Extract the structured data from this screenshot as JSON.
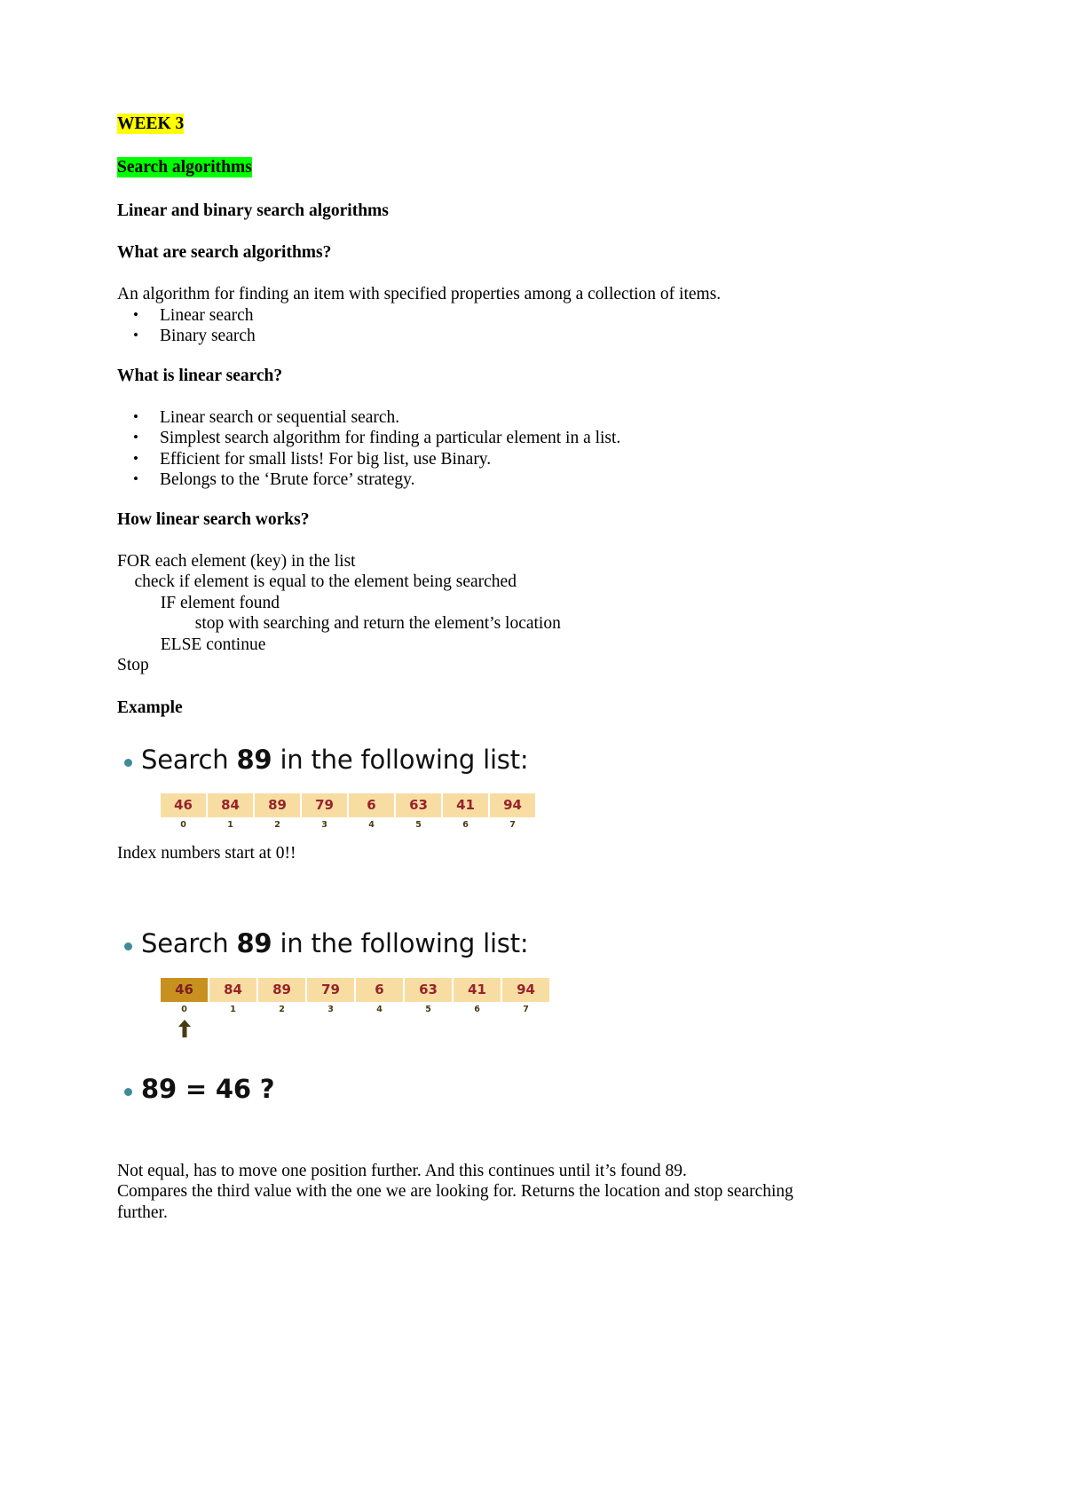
{
  "document": {
    "week_heading": "WEEK 3",
    "topic_heading": "Search algorithms",
    "subtitle": "Linear and binary search algorithms",
    "q1": "What are search algorithms?",
    "definition": "An algorithm for finding an item with specified properties among a collection of items.",
    "definition_bullets": [
      "Linear search",
      "Binary search"
    ],
    "q2": "What is linear search?",
    "linear_bullets": [
      "Linear search or sequential search.",
      "Simplest search algorithm for finding a particular element in a list.",
      "Efficient for small lists! For big list, use Binary.",
      "Belongs to the ‘Brute force’ strategy."
    ],
    "q3": "How linear search works?",
    "pseudocode": "FOR each element (key) in the list\n    check if element is equal to the element being searched\n          IF element found\n                  stop with searching and return the element’s location\n          ELSE continue\nStop",
    "example_heading": "Example",
    "index_note": "Index numbers start at 0!!",
    "conclusion_line1": "Not equal, has to move one position further. And this continues until it’s found 89.",
    "conclusion_line2": "Compares the third value with the one we are looking for. Returns the location and stop searching further."
  },
  "slide1": {
    "title_prefix": "Search ",
    "title_key": "89",
    "title_suffix": " in the following list:",
    "array": {
      "values": [
        "46",
        "84",
        "89",
        "79",
        "6",
        "63",
        "41",
        "94"
      ],
      "indices": [
        "0",
        "1",
        "2",
        "3",
        "4",
        "5",
        "6",
        "7"
      ],
      "highlight_index": -1
    }
  },
  "slide2": {
    "title_prefix": "Search ",
    "title_key": "89",
    "title_suffix": " in the following list:",
    "array": {
      "values": [
        "46",
        "84",
        "89",
        "79",
        "6",
        "63",
        "41",
        "94"
      ],
      "indices": [
        "0",
        "1",
        "2",
        "3",
        "4",
        "5",
        "6",
        "7"
      ],
      "highlight_index": 0,
      "pointer_index": 0
    }
  },
  "slide3": {
    "comparison": "89 = 46 ?"
  },
  "colors": {
    "week_highlight": "#ffff00",
    "topic_highlight": "#00ff00",
    "cell_fill": "#f8dda3",
    "cell_fill_active": "#c8911f",
    "cell_text": "#96242b",
    "index_text": "#4a3a12",
    "slide_bullet": "#3f8a9b",
    "arrow": "#4a3a12"
  }
}
